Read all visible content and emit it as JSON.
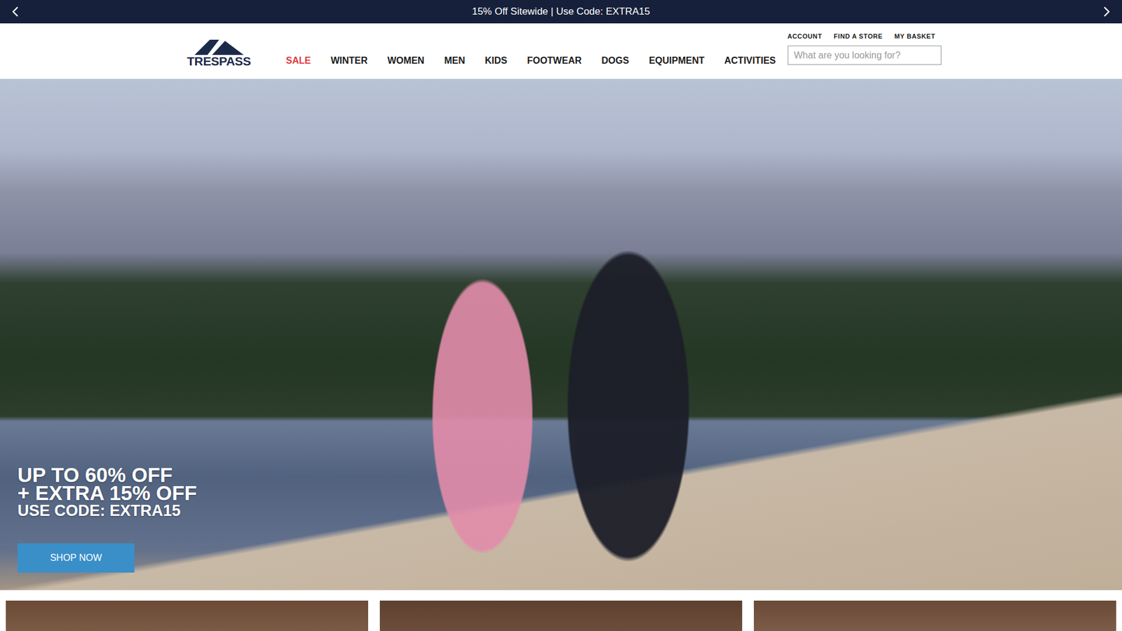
{
  "announcement": {
    "text": "15% Off Sitewide | Use Code: EXTRA15"
  },
  "header": {
    "logo": "TRESPASS",
    "nav": [
      {
        "label": "SALE",
        "highlighted": true
      },
      {
        "label": "WINTER",
        "highlighted": false
      },
      {
        "label": "WOMEN",
        "highlighted": false
      },
      {
        "label": "MEN",
        "highlighted": false
      },
      {
        "label": "KIDS",
        "highlighted": false
      },
      {
        "label": "FOOTWEAR",
        "highlighted": false
      },
      {
        "label": "DOGS",
        "highlighted": false
      },
      {
        "label": "EQUIPMENT",
        "highlighted": false
      },
      {
        "label": "ACTIVITIES",
        "highlighted": false
      }
    ],
    "utility_links": [
      "ACCOUNT",
      "FIND A STORE",
      "MY BASKET"
    ],
    "search": {
      "placeholder": "What are you looking for?"
    }
  },
  "hero": {
    "headline": [
      "UP TO 60% OFF",
      "+ EXTRA 15% OFF"
    ],
    "subline": "USE CODE: EXTRA15",
    "button": "SHOP NOW"
  }
}
